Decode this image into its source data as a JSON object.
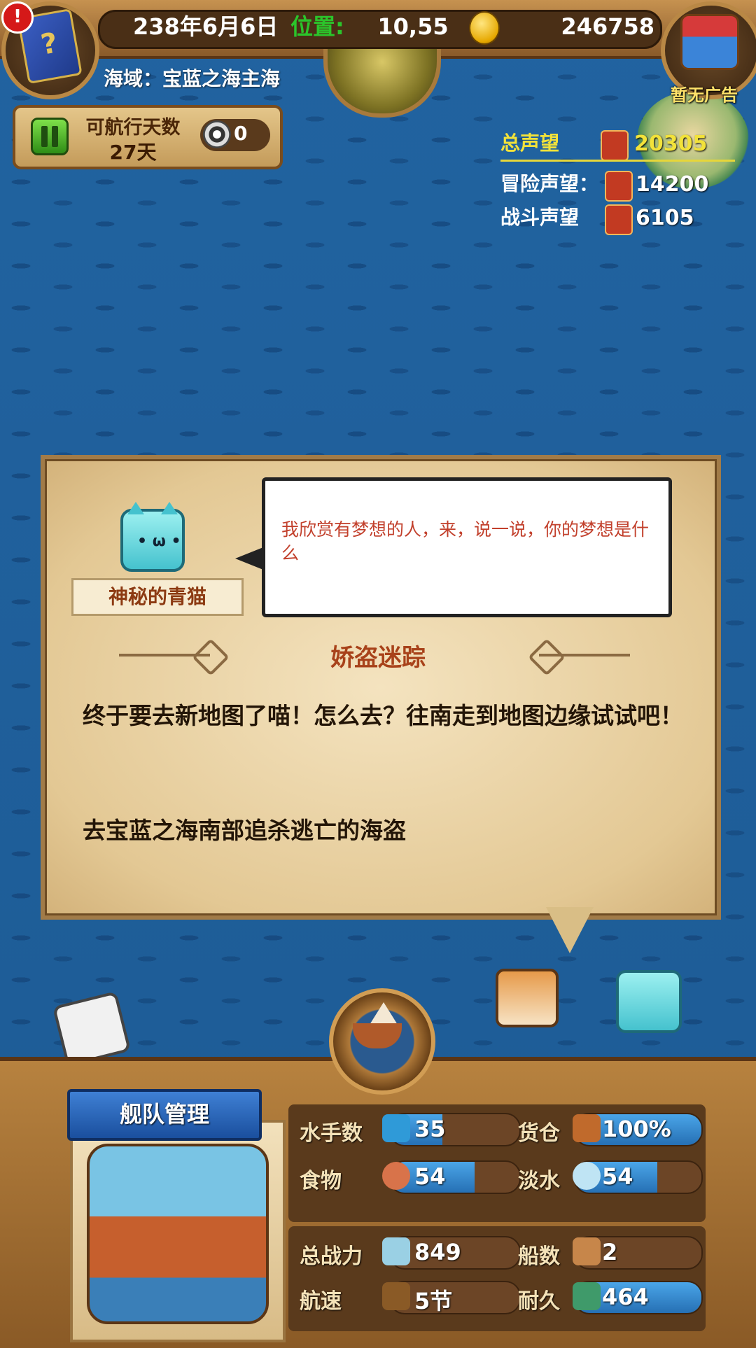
{
  "topbar": {
    "date": "238年6月6日",
    "position_label": "位置:",
    "position_value": "10,55",
    "gold": "246758",
    "sea_region": "海域：宝蓝之海主海",
    "no_ad": "暂无广告",
    "alert_mark": "!"
  },
  "days": {
    "label": "可航行天数",
    "value": "27天",
    "wheel_count": "0"
  },
  "reputation": {
    "total_label": "总声望",
    "total_value": "20305",
    "adventure_label": "冒险声望：",
    "adventure_value": "14200",
    "battle_label": "战斗声望",
    "battle_value": "6105",
    "colors": {
      "total": "#f2e23a",
      "highlight": "#e6d63a"
    }
  },
  "dialog": {
    "npc_name": "神秘的青猫",
    "speech": "我欣赏有梦想的人，来，说一说，你的梦想是什么",
    "quest_title": "娇盗迷踪",
    "quest_body": "终于要去新地图了喵！怎么去？往南走到地图边缘试试吧！",
    "quest_goal": "去宝蓝之海南部追杀逃亡的海盗"
  },
  "fleet": {
    "title": "舰队管理",
    "stats": {
      "sailors": {
        "label": "水手数",
        "value": "35",
        "fill": 0.4
      },
      "cargo": {
        "label": "货仓",
        "value": "100%",
        "fill": 1.0
      },
      "food": {
        "label": "食物",
        "value": "54",
        "fill": 0.65
      },
      "water": {
        "label": "淡水",
        "value": "54",
        "fill": 0.65
      },
      "power": {
        "label": "总战力",
        "value": "849",
        "fill": 0.0
      },
      "ships": {
        "label": "船数",
        "value": "2",
        "fill": 0.0
      },
      "speed": {
        "label": "航速",
        "value": "5节",
        "fill": 0.0
      },
      "durability": {
        "label": "耐久",
        "value": "464",
        "fill": 1.0
      }
    }
  },
  "icons": [
    "book-icon",
    "treasure-chest-icon",
    "gold-coin-icon",
    "globe-icon",
    "pause-icon",
    "helm-wheel-icon",
    "sailor-icon",
    "crate-icon",
    "meat-icon",
    "water-jug-icon",
    "sword-icon",
    "ship-icon",
    "ship-helm-icon"
  ]
}
